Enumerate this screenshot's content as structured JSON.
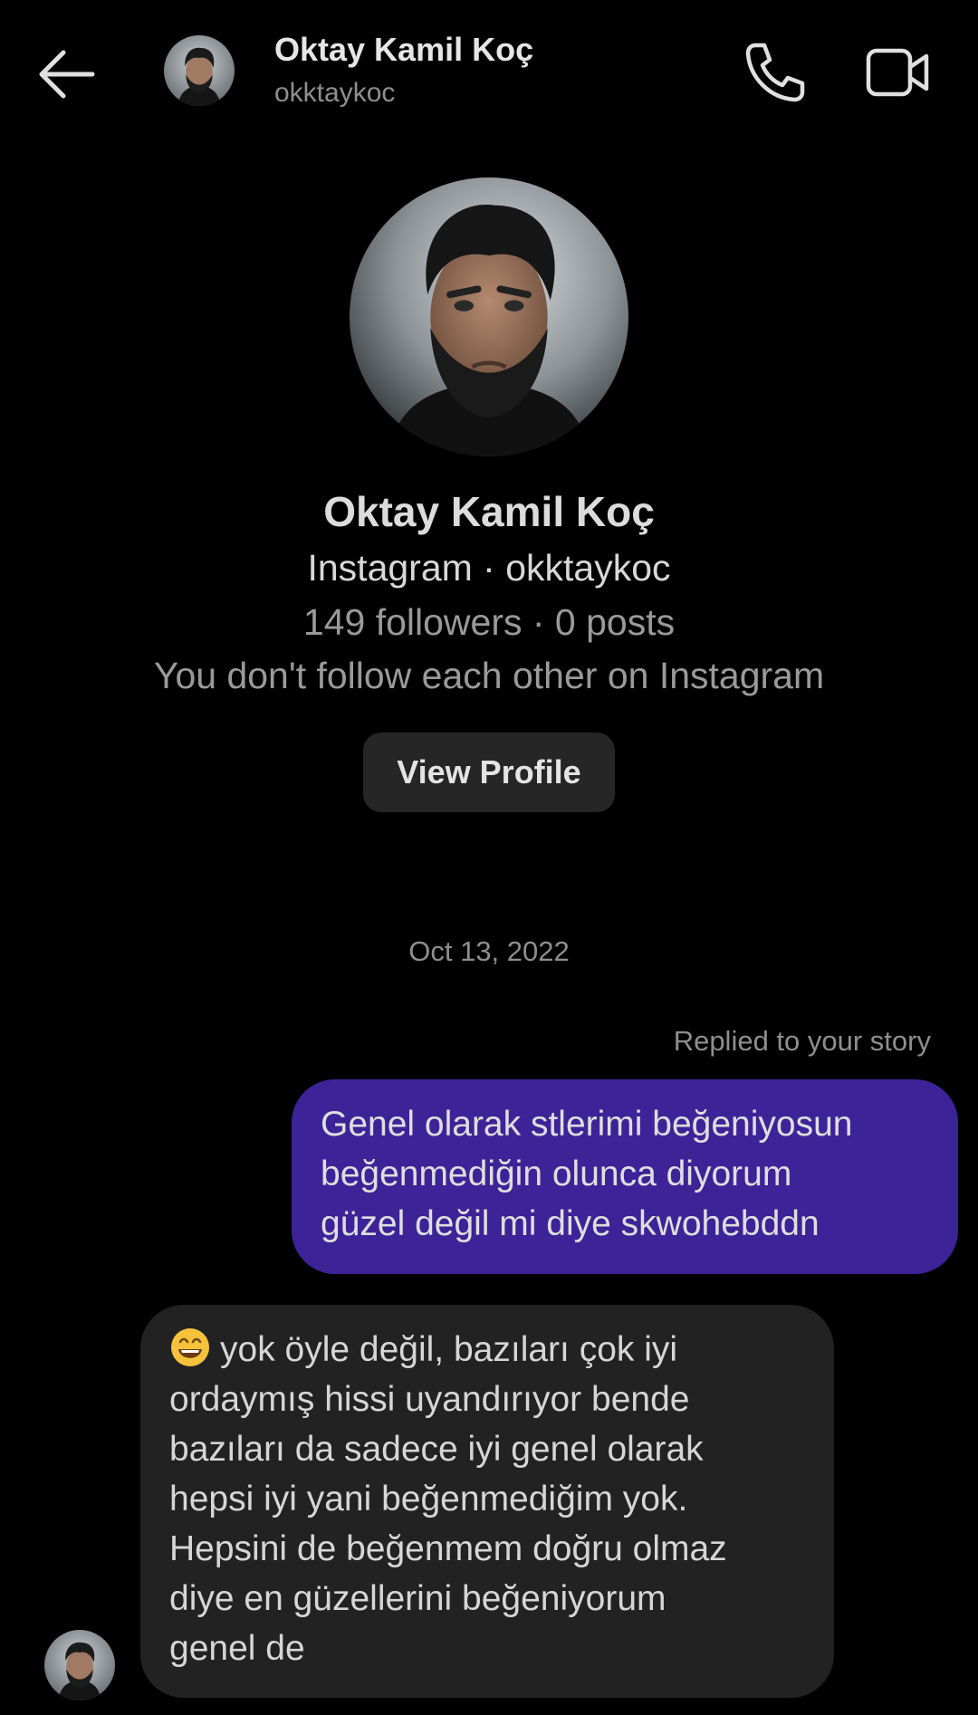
{
  "header": {
    "name": "Oktay Kamil Koç",
    "username": "okktaykoc",
    "back_icon": "arrow-left-icon",
    "call_icon": "phone-icon",
    "video_icon": "video-camera-icon"
  },
  "profile": {
    "name": "Oktay Kamil Koç",
    "source": "Instagram · okktaykoc",
    "stats": "149 followers · 0 posts",
    "relation": "You don't follow each other on Instagram",
    "view_profile_label": "View Profile"
  },
  "chat": {
    "date": "Oct 13, 2022",
    "outgoing": {
      "context": "Replied to your story",
      "lines": [
        "Genel olarak stlerimi beğeniyosun",
        "beğenmediğin olunca diyorum",
        "güzel değil mi diye skwohebddn"
      ]
    },
    "incoming": {
      "emoji": "grinning-face-icon",
      "lines": [
        "yok öyle değil, bazıları çok iyi",
        "ordaymış hissi uyandırıyor bende",
        "bazıları da sadece iyi genel olarak",
        "hepsi iyi yani beğenmediğim yok.",
        "Hepsini de beğenmem doğru olmaz",
        "diye en güzellerini beğeniyorum",
        "genel de"
      ]
    }
  },
  "colors": {
    "background": "#000000",
    "outgoing_bubble": "#3d2398",
    "incoming_bubble": "#222222",
    "button": "#262626"
  }
}
